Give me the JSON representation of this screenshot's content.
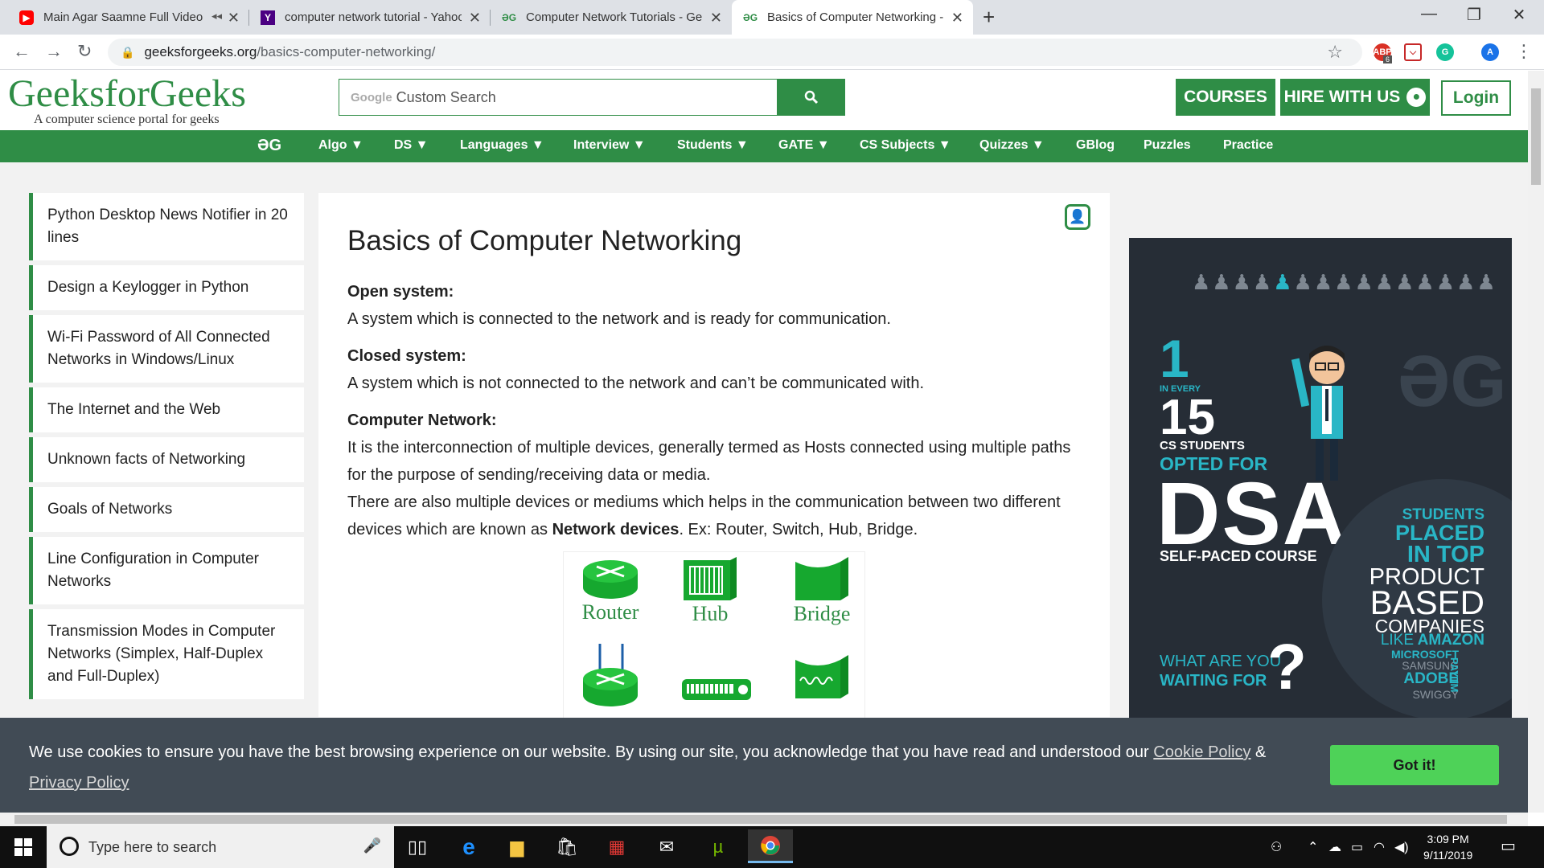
{
  "browser": {
    "tabs": [
      {
        "title": "Main Agar Saamne Full Video",
        "icon": "youtube-icon"
      },
      {
        "title": "computer network tutorial - Yahoo",
        "icon": "yahoo-icon"
      },
      {
        "title": "Computer Network Tutorials - Ge",
        "icon": "gfg-icon"
      },
      {
        "title": "Basics of Computer Networking -",
        "icon": "gfg-icon"
      }
    ],
    "url_host": "geeksforgeeks.org",
    "url_path": "/basics-computer-networking/",
    "profile_initial": "A",
    "abp_count": "6"
  },
  "site": {
    "logo": "GeeksforGeeks",
    "tagline": "A computer science portal for geeks",
    "search_brand": "Google",
    "search_placeholder": "Custom Search",
    "courses": "COURSES",
    "hire": "HIRE WITH US",
    "login": "Login"
  },
  "nav": {
    "logo": "ƏG",
    "items": [
      "Algo ▼",
      "DS ▼",
      "Languages ▼",
      "Interview ▼",
      "Students ▼",
      "GATE ▼",
      "CS Subjects ▼",
      "Quizzes ▼",
      "GBlog",
      "Puzzles",
      "Practice"
    ]
  },
  "sidebar": [
    "Python Desktop News Notifier in 20 lines",
    "Design a Keylogger in Python",
    "Wi-Fi Password of All Connected Networks in Windows/Linux",
    "The Internet and the Web",
    "Unknown facts of Networking",
    "Goals of Networks",
    "Line Configuration in Computer Networks",
    "Transmission Modes in Computer Networks (Simplex, Half-Duplex and Full-Duplex)"
  ],
  "article": {
    "title": "Basics of Computer Networking",
    "open_h": "Open system:",
    "open_t": "A system which is connected to the network and is ready for communication.",
    "closed_h": "Closed system:",
    "closed_t": "A system which is not connected to the network and can’t be communicated with.",
    "cn_h": "Computer Network:",
    "cn_t": "It is the interconnection of multiple devices, generally termed as Hosts connected using multiple paths for the purpose of sending/receiving data or media.",
    "cn_t2_pre": "There are also multiple devices or mediums which helps in the communication between two different devices which are known as",
    "cn_t2_bold": "Network devices",
    "cn_t2_post": ". Ex: Router, Switch, Hub, Bridge.",
    "devices": [
      "Router",
      "Hub",
      "Bridge"
    ]
  },
  "ad": {
    "one": "1",
    "in_every": "IN EVERY",
    "fifteen": "15",
    "cs_students": "CS STUDENTS",
    "opted": "OPTED FOR",
    "dsa": "DSA",
    "course": "SELF-PACED COURSE",
    "students": "STUDENTS",
    "placed": "PLACED",
    "in_top": "IN TOP",
    "product": "PRODUCT",
    "based": "BASED",
    "companies": "COMPANIES",
    "like": "LIKE",
    "amazon": "AMAZON",
    "microsoft": "MICROSOFT",
    "samsung": "SAMSUNG",
    "adobe": "ADOBE",
    "paytm": "PAYTM",
    "swiggy": "SWIGGY",
    "what": "WHAT ARE YOU",
    "waiting": "WAITING FOR",
    "q": "?"
  },
  "cookie": {
    "text": "We use cookies to ensure you have the best browsing experience on our website. By using our site, you acknowledge that you have read and understood our",
    "policy": "Cookie Policy",
    "amp": "&",
    "privacy": "Privacy Policy",
    "button": "Got it!"
  },
  "taskbar": {
    "search_placeholder": "Type here to search",
    "time": "3:09 PM",
    "date": "9/11/2019"
  }
}
